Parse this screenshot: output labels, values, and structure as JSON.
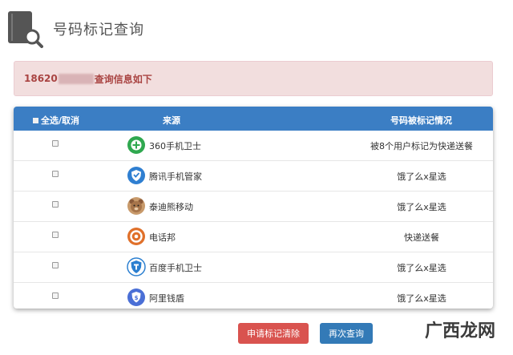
{
  "header": {
    "title": "号码标记查询",
    "icon": "book-search-icon"
  },
  "alert": {
    "prefix": "18620",
    "suffix": "查询信息如下"
  },
  "table": {
    "headers": {
      "select_all": "全选/取消",
      "source": "来源",
      "status": "号码被标记情况"
    },
    "rows": [
      {
        "icon": "360-shield-icon",
        "color": "#2fa84f",
        "source": "360手机卫士",
        "status": "被8个用户标记为快递送餐"
      },
      {
        "icon": "tencent-shield-icon",
        "color": "#2f7fd1",
        "source": "腾讯手机管家",
        "status": "饿了么x星选"
      },
      {
        "icon": "teddy-bear-icon",
        "color": "#8a5a3a",
        "source": "泰迪熊移动",
        "status": "饿了么x星选"
      },
      {
        "icon": "phone-bang-icon",
        "color": "#e0702a",
        "source": "电话邦",
        "status": "快递送餐"
      },
      {
        "icon": "baidu-guard-icon",
        "color": "#2b7fd0",
        "source": "百度手机卫士",
        "status": "饿了么x星选"
      },
      {
        "icon": "ali-shield-icon",
        "color": "#4a6fd6",
        "source": "阿里钱盾",
        "status": "饿了么x星选"
      }
    ]
  },
  "buttons": {
    "clear": "申请标记清除",
    "requery": "再次查询"
  },
  "watermark": {
    "text": "广西龙网"
  }
}
